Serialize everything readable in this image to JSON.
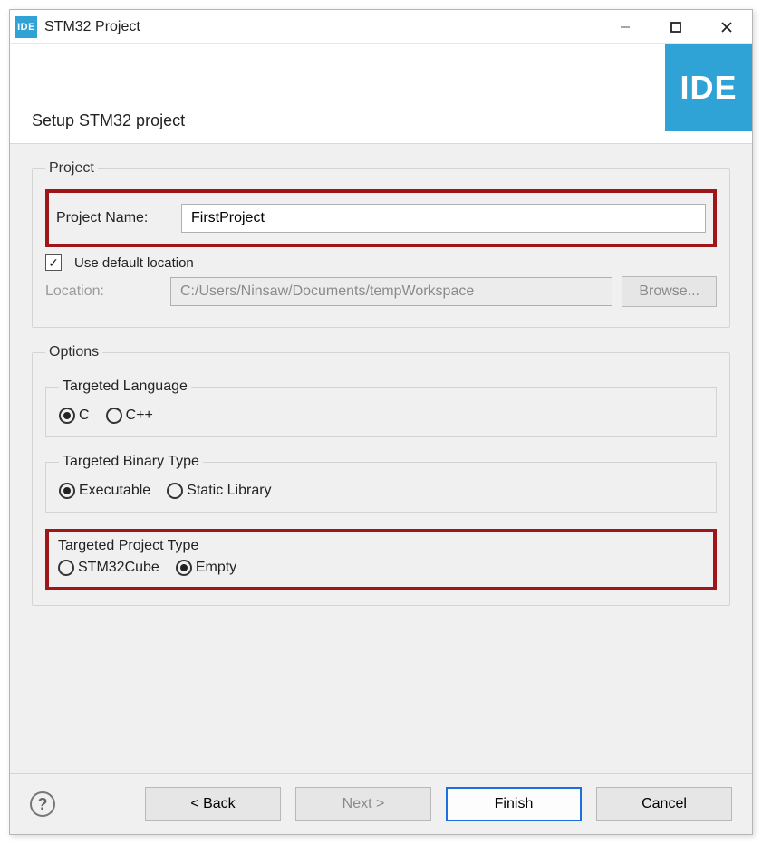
{
  "titlebar": {
    "app_icon_text": "IDE",
    "title": "STM32 Project"
  },
  "header": {
    "subtitle": "Setup STM32 project",
    "logo_text": "IDE"
  },
  "project": {
    "legend": "Project",
    "name_label": "Project Name:",
    "name_value": "FirstProject",
    "use_default_label": "Use default location",
    "use_default_checked": true,
    "location_label": "Location:",
    "location_value": "C:/Users/Ninsaw/Documents/tempWorkspace",
    "browse_label": "Browse..."
  },
  "options": {
    "legend": "Options",
    "language": {
      "legend": "Targeted Language",
      "items": [
        {
          "label": "C",
          "selected": true
        },
        {
          "label": "C++",
          "selected": false
        }
      ]
    },
    "binary_type": {
      "legend": "Targeted Binary Type",
      "items": [
        {
          "label": "Executable",
          "selected": true
        },
        {
          "label": "Static Library",
          "selected": false
        }
      ]
    },
    "project_type": {
      "legend": "Targeted Project Type",
      "items": [
        {
          "label": "STM32Cube",
          "selected": false
        },
        {
          "label": "Empty",
          "selected": true
        }
      ]
    }
  },
  "footer": {
    "back": "< Back",
    "next": "Next >",
    "finish": "Finish",
    "cancel": "Cancel"
  }
}
